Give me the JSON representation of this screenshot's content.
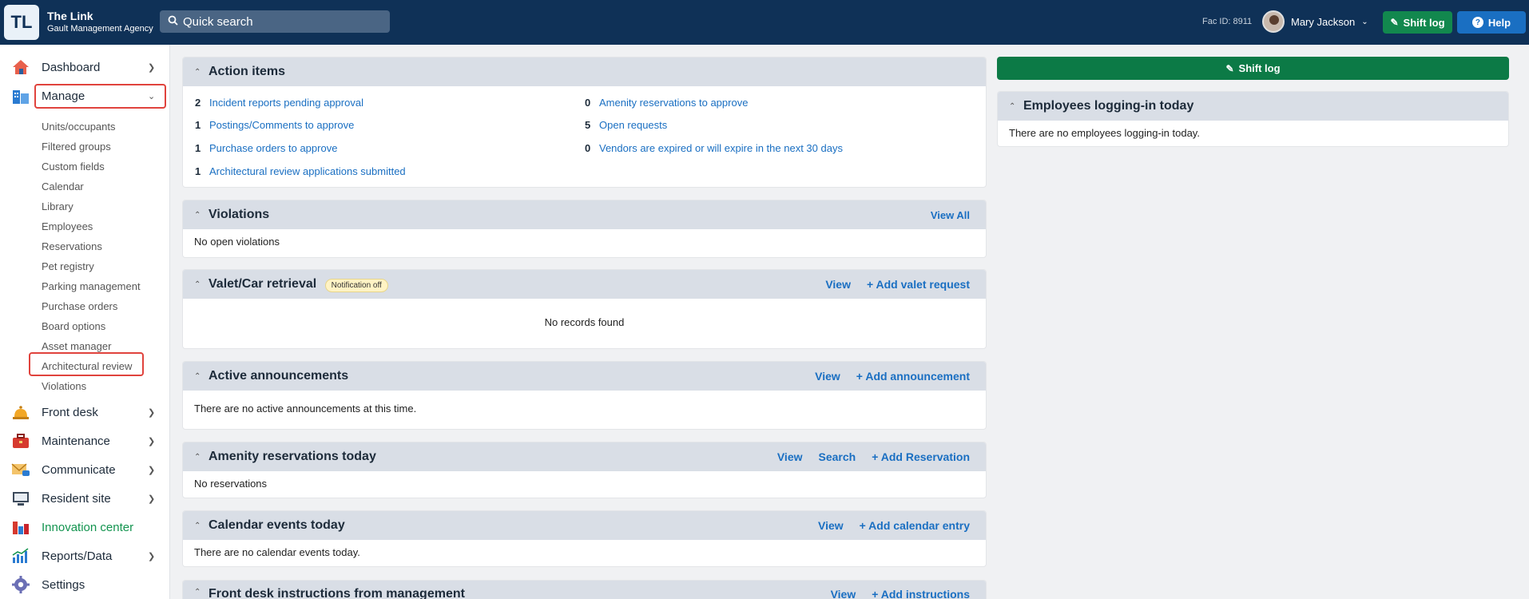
{
  "header": {
    "logo_text": "TL",
    "app_name": "The Link",
    "agency": "Gault Management Agency",
    "search_placeholder": "Quick search",
    "fac_id": "Fac ID: 8911",
    "user_name": "Mary Jackson",
    "shift_log_label": "Shift log",
    "help_label": "Help"
  },
  "sidebar": {
    "items": [
      {
        "label": "Dashboard",
        "icon": "house-icon"
      },
      {
        "label": "Manage",
        "icon": "buildings-icon"
      },
      {
        "label": "Front desk",
        "icon": "bell-icon"
      },
      {
        "label": "Maintenance",
        "icon": "toolbox-icon"
      },
      {
        "label": "Communicate",
        "icon": "envelope-icon"
      },
      {
        "label": "Resident site",
        "icon": "monitor-icon"
      },
      {
        "label": "Innovation center",
        "icon": "lab-icon"
      },
      {
        "label": "Reports/Data",
        "icon": "chart-icon"
      },
      {
        "label": "Settings",
        "icon": "gear-icon"
      }
    ],
    "manage_sub": [
      "Units/occupants",
      "Filtered groups",
      "Custom fields",
      "Calendar",
      "Library",
      "Employees",
      "Reservations",
      "Pet registry",
      "Parking management",
      "Purchase orders",
      "Board options",
      "Asset manager",
      "Architectural review",
      "Violations"
    ]
  },
  "action_items": {
    "title": "Action items",
    "left": [
      {
        "count": "2",
        "label": "Incident reports pending approval"
      },
      {
        "count": "1",
        "label": "Postings/Comments to approve"
      },
      {
        "count": "1",
        "label": "Purchase orders to approve"
      },
      {
        "count": "1",
        "label": "Architectural review applications submitted"
      }
    ],
    "right": [
      {
        "count": "0",
        "label": "Amenity reservations to approve"
      },
      {
        "count": "5",
        "label": "Open requests"
      },
      {
        "count": "0",
        "label": "Vendors are expired or will expire in the next 30 days"
      }
    ]
  },
  "violations": {
    "title": "Violations",
    "view_all": "View All",
    "body": "No open violations"
  },
  "valet": {
    "title": "Valet/Car retrieval",
    "badge": "Notification off",
    "view": "View",
    "add": "+ Add valet request",
    "body": "No records found"
  },
  "announcements": {
    "title": "Active announcements",
    "view": "View",
    "add": "+ Add announcement",
    "body": "There are no active announcements at this time."
  },
  "amenity": {
    "title": "Amenity reservations today",
    "view": "View",
    "search": "Search",
    "add": "+ Add Reservation",
    "body": "No reservations"
  },
  "calendar": {
    "title": "Calendar events today",
    "view": "View",
    "add": "+ Add calendar entry",
    "body": "There are no calendar events today."
  },
  "frontdesk": {
    "title": "Front desk instructions from management",
    "view": "View",
    "add": "+ Add instructions"
  },
  "right_col": {
    "shift_log_label": "Shift log",
    "employees_title": "Employees logging-in today",
    "employees_body": "There are no employees logging-in today."
  },
  "colors": {
    "navy": "#0f3157",
    "green": "#12884e",
    "blue": "#1a6fc2",
    "highlight": "#e0433d"
  }
}
